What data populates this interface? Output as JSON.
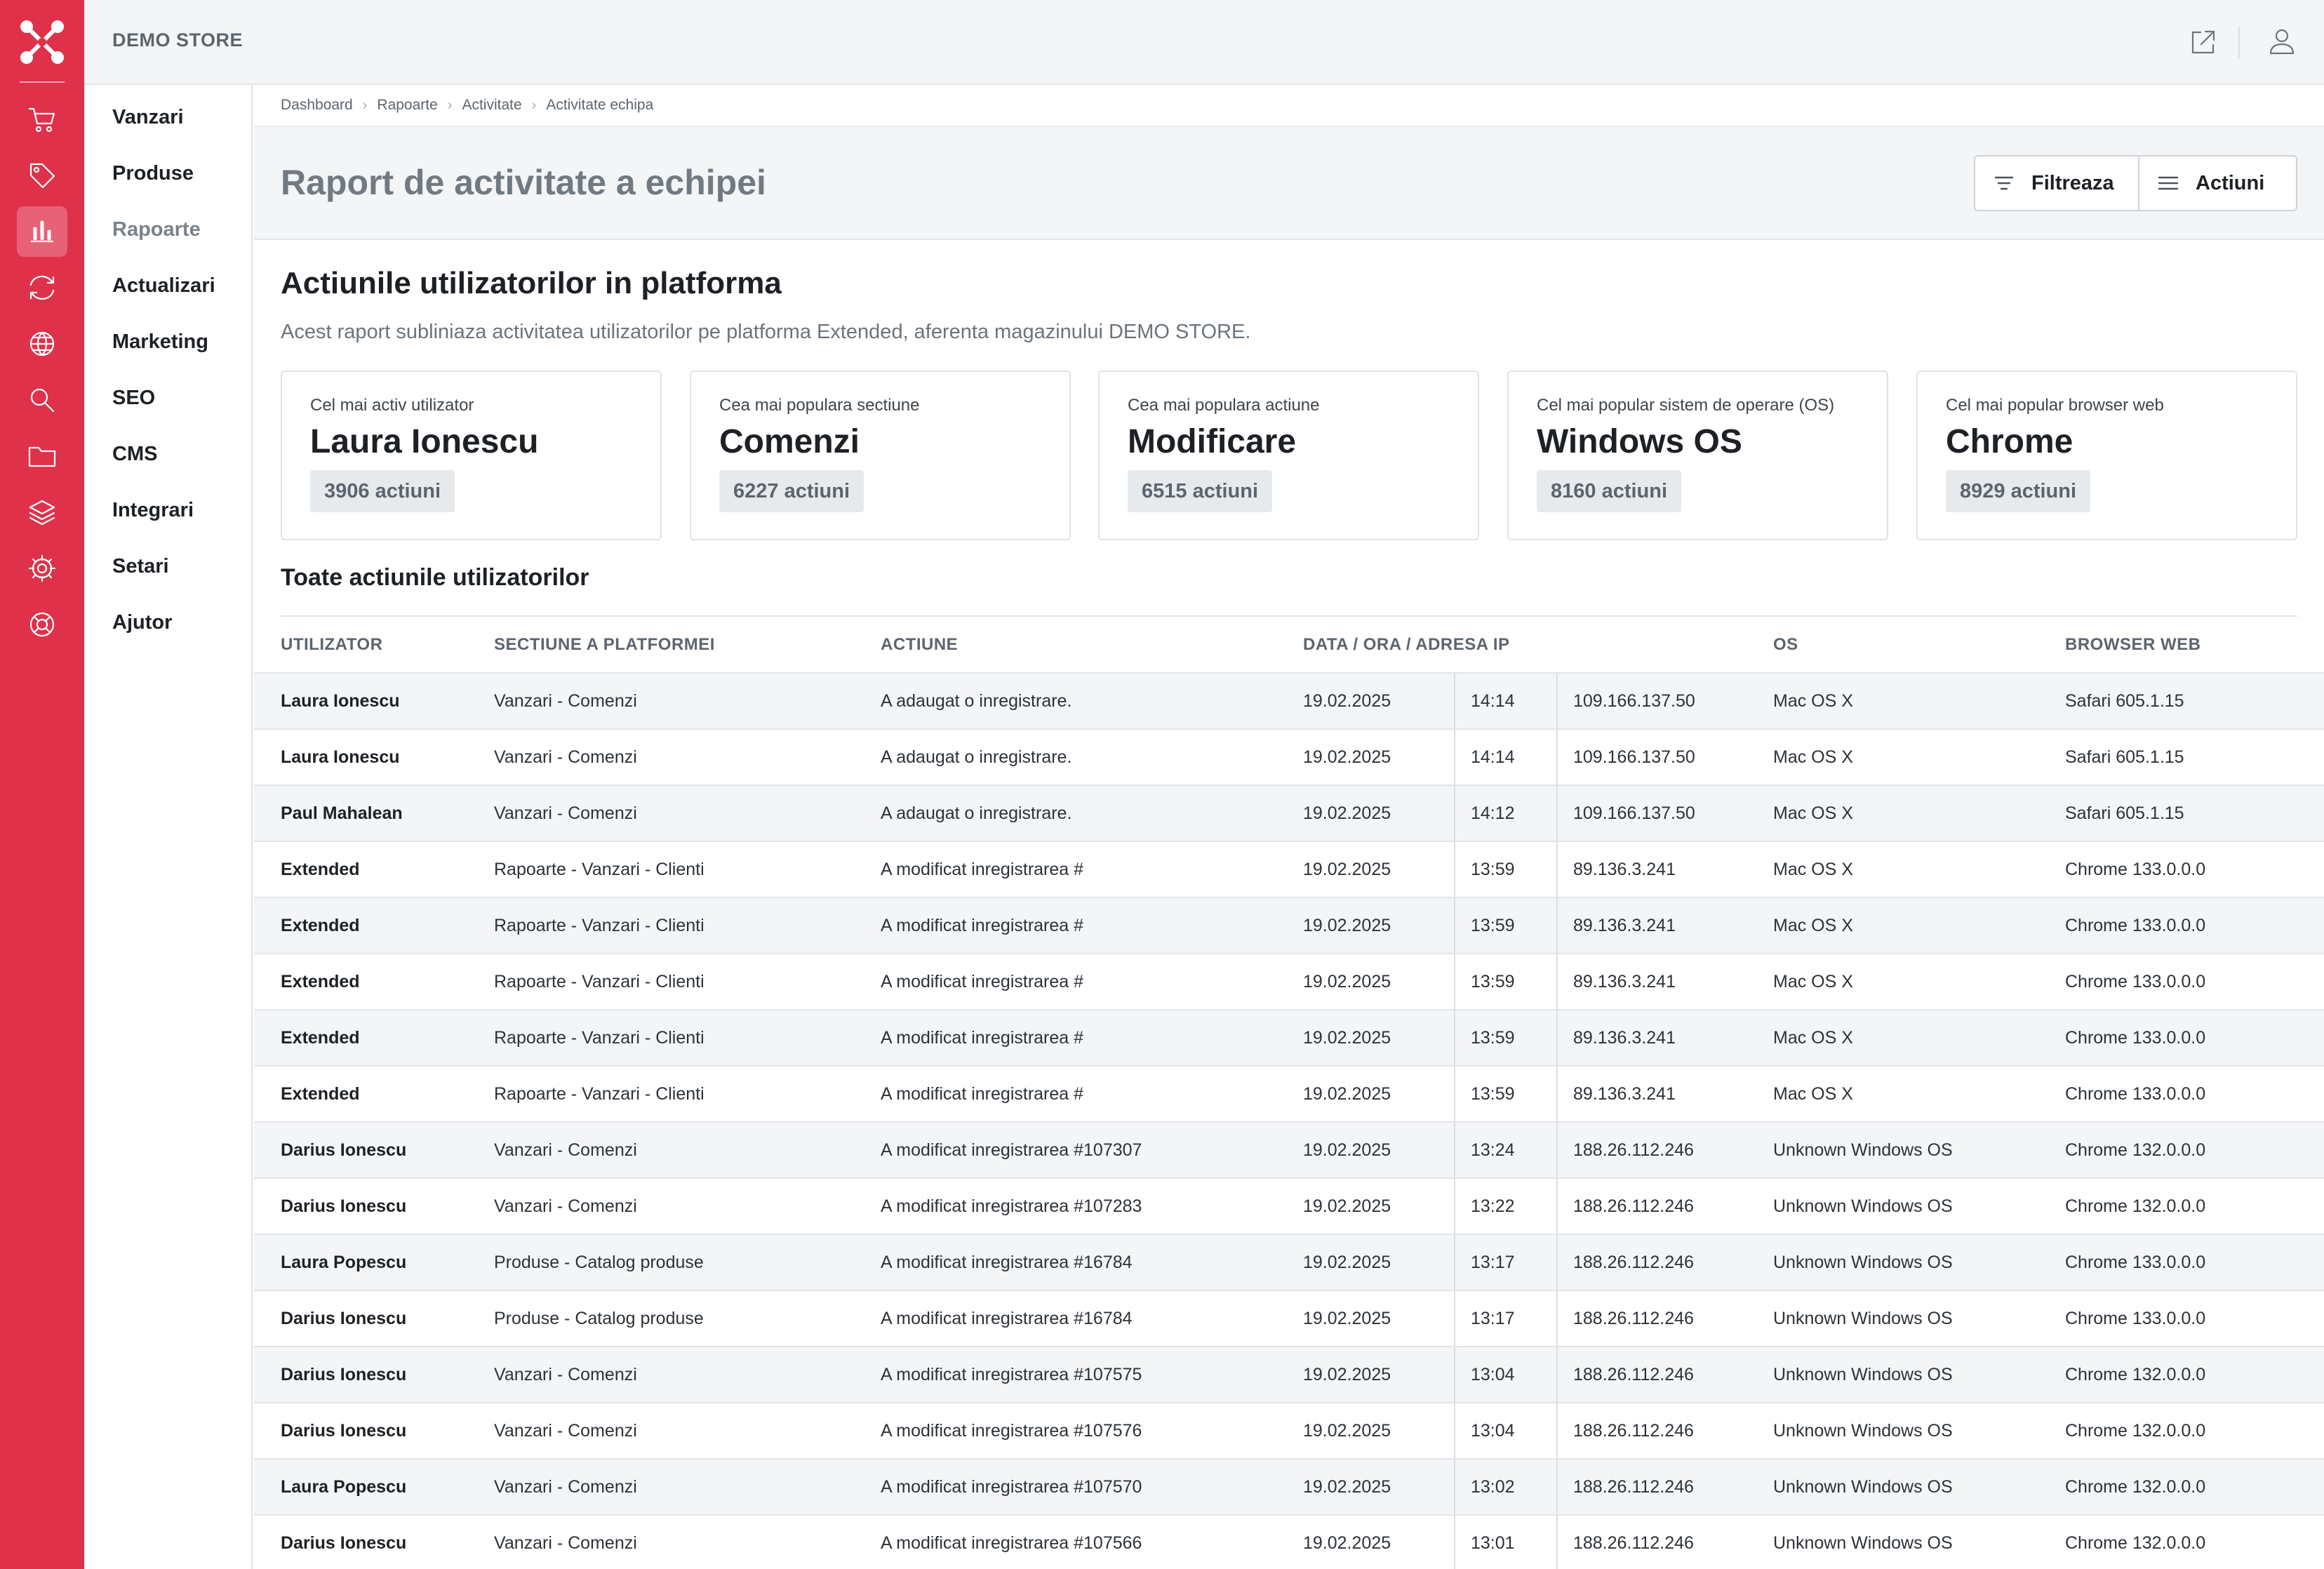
{
  "app": {
    "store_name": "DEMO STORE"
  },
  "rail": {
    "icons": [
      "logo-icon",
      "cart-icon",
      "tag-icon",
      "chart-icon",
      "sync-icon",
      "globe-icon",
      "search-icon",
      "folder-icon",
      "layers-icon",
      "gear-icon",
      "lifebuoy-icon"
    ],
    "active": "chart-icon"
  },
  "topbar": {
    "icons": [
      "external-link-icon",
      "user-icon"
    ]
  },
  "menu": {
    "items": [
      "Vanzari",
      "Produse",
      "Rapoarte",
      "Actualizari",
      "Marketing",
      "SEO",
      "CMS",
      "Integrari",
      "Setari",
      "Ajutor"
    ],
    "active": "Rapoarte"
  },
  "breadcrumb": [
    "Dashboard",
    "Rapoarte",
    "Activitate",
    "Activitate echipa"
  ],
  "page": {
    "title": "Raport de activitate a echipei",
    "filter_label": "Filtreaza",
    "actions_label": "Actiuni"
  },
  "section": {
    "title": "Actiunile utilizatorilor in platforma",
    "description": "Acest raport subliniaza activitatea utilizatorilor pe platforma Extended, aferenta magazinului DEMO STORE."
  },
  "cards": [
    {
      "label": "Cel mai activ utilizator",
      "value": "Laura Ionescu",
      "count": "3906 actiuni"
    },
    {
      "label": "Cea mai populara sectiune",
      "value": "Comenzi",
      "count": "6227 actiuni"
    },
    {
      "label": "Cea mai populara actiune",
      "value": "Modificare",
      "count": "6515 actiuni"
    },
    {
      "label": "Cel mai popular sistem de operare (OS)",
      "value": "Windows OS",
      "count": "8160 actiuni"
    },
    {
      "label": "Cel mai popular browser web",
      "value": "Chrome",
      "count": "8929 actiuni"
    }
  ],
  "table": {
    "title": "Toate actiunile utilizatorilor",
    "columns": {
      "user": "UTILIZATOR",
      "section": "SECTIUNE A PLATFORMEI",
      "action": "ACTIUNE",
      "datetime_ip": "DATA / ORA / ADRESA IP",
      "os": "OS",
      "browser": "BROWSER WEB"
    },
    "rows": [
      {
        "user": "Laura Ionescu",
        "section": "Vanzari - Comenzi",
        "action": "A adaugat o inregistrare.",
        "date": "19.02.2025",
        "time": "14:14",
        "ip": "109.166.137.50",
        "os": "Mac OS X",
        "browser": "Safari 605.1.15"
      },
      {
        "user": "Laura Ionescu",
        "section": "Vanzari - Comenzi",
        "action": "A adaugat o inregistrare.",
        "date": "19.02.2025",
        "time": "14:14",
        "ip": "109.166.137.50",
        "os": "Mac OS X",
        "browser": "Safari 605.1.15"
      },
      {
        "user": "Paul Mahalean",
        "section": "Vanzari - Comenzi",
        "action": "A adaugat o inregistrare.",
        "date": "19.02.2025",
        "time": "14:12",
        "ip": "109.166.137.50",
        "os": "Mac OS X",
        "browser": "Safari 605.1.15"
      },
      {
        "user": "Extended",
        "section": "Rapoarte - Vanzari - Clienti",
        "action": "A modificat inregistrarea #",
        "date": "19.02.2025",
        "time": "13:59",
        "ip": "89.136.3.241",
        "os": "Mac OS X",
        "browser": "Chrome 133.0.0.0"
      },
      {
        "user": "Extended",
        "section": "Rapoarte - Vanzari - Clienti",
        "action": "A modificat inregistrarea #",
        "date": "19.02.2025",
        "time": "13:59",
        "ip": "89.136.3.241",
        "os": "Mac OS X",
        "browser": "Chrome 133.0.0.0"
      },
      {
        "user": "Extended",
        "section": "Rapoarte - Vanzari - Clienti",
        "action": "A modificat inregistrarea #",
        "date": "19.02.2025",
        "time": "13:59",
        "ip": "89.136.3.241",
        "os": "Mac OS X",
        "browser": "Chrome 133.0.0.0"
      },
      {
        "user": "Extended",
        "section": "Rapoarte - Vanzari - Clienti",
        "action": "A modificat inregistrarea #",
        "date": "19.02.2025",
        "time": "13:59",
        "ip": "89.136.3.241",
        "os": "Mac OS X",
        "browser": "Chrome 133.0.0.0"
      },
      {
        "user": "Extended",
        "section": "Rapoarte - Vanzari - Clienti",
        "action": "A modificat inregistrarea #",
        "date": "19.02.2025",
        "time": "13:59",
        "ip": "89.136.3.241",
        "os": "Mac OS X",
        "browser": "Chrome 133.0.0.0"
      },
      {
        "user": "Darius Ionescu",
        "section": "Vanzari - Comenzi",
        "action": "A modificat inregistrarea #107307",
        "date": "19.02.2025",
        "time": "13:24",
        "ip": "188.26.112.246",
        "os": "Unknown Windows OS",
        "browser": "Chrome 132.0.0.0"
      },
      {
        "user": "Darius Ionescu",
        "section": "Vanzari - Comenzi",
        "action": "A modificat inregistrarea #107283",
        "date": "19.02.2025",
        "time": "13:22",
        "ip": "188.26.112.246",
        "os": "Unknown Windows OS",
        "browser": "Chrome 132.0.0.0"
      },
      {
        "user": "Laura Popescu",
        "section": "Produse - Catalog produse",
        "action": "A modificat inregistrarea #16784",
        "date": "19.02.2025",
        "time": "13:17",
        "ip": "188.26.112.246",
        "os": "Unknown Windows OS",
        "browser": "Chrome 133.0.0.0"
      },
      {
        "user": "Darius Ionescu",
        "section": "Produse - Catalog produse",
        "action": "A modificat inregistrarea #16784",
        "date": "19.02.2025",
        "time": "13:17",
        "ip": "188.26.112.246",
        "os": "Unknown Windows OS",
        "browser": "Chrome 133.0.0.0"
      },
      {
        "user": "Darius Ionescu",
        "section": "Vanzari - Comenzi",
        "action": "A modificat inregistrarea #107575",
        "date": "19.02.2025",
        "time": "13:04",
        "ip": "188.26.112.246",
        "os": "Unknown Windows OS",
        "browser": "Chrome 132.0.0.0"
      },
      {
        "user": "Darius Ionescu",
        "section": "Vanzari - Comenzi",
        "action": "A modificat inregistrarea #107576",
        "date": "19.02.2025",
        "time": "13:04",
        "ip": "188.26.112.246",
        "os": "Unknown Windows OS",
        "browser": "Chrome 132.0.0.0"
      },
      {
        "user": "Laura Popescu",
        "section": "Vanzari - Comenzi",
        "action": "A modificat inregistrarea #107570",
        "date": "19.02.2025",
        "time": "13:02",
        "ip": "188.26.112.246",
        "os": "Unknown Windows OS",
        "browser": "Chrome 132.0.0.0"
      },
      {
        "user": "Darius Ionescu",
        "section": "Vanzari - Comenzi",
        "action": "A modificat inregistrarea #107566",
        "date": "19.02.2025",
        "time": "13:01",
        "ip": "188.26.112.246",
        "os": "Unknown Windows OS",
        "browser": "Chrome 132.0.0.0"
      }
    ]
  }
}
